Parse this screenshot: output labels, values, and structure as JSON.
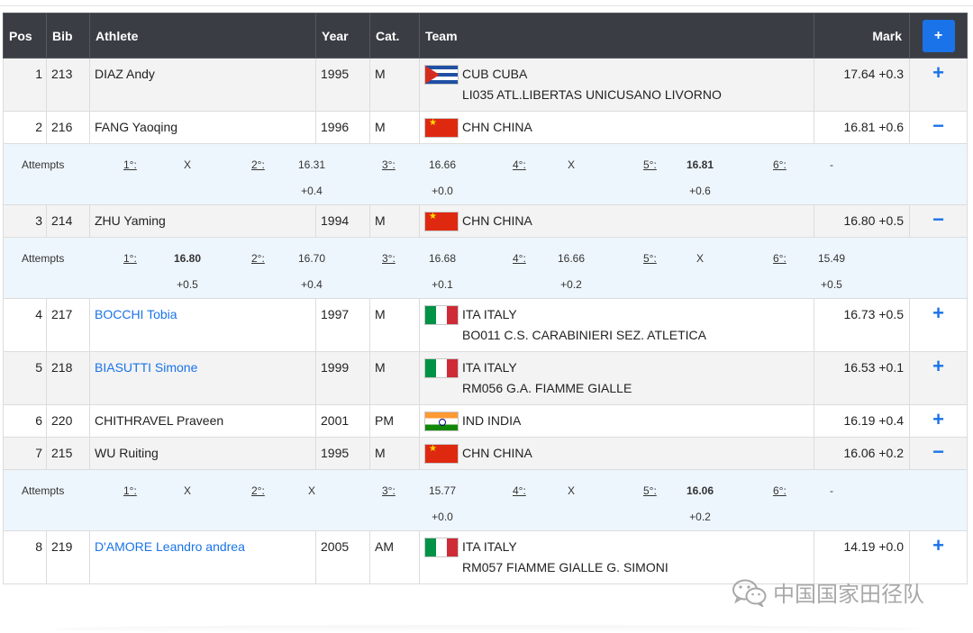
{
  "header": {
    "pos": "Pos",
    "bib": "Bib",
    "athlete": "Athlete",
    "year": "Year",
    "cat": "Cat.",
    "team": "Team",
    "mark": "Mark",
    "expand_all": "+"
  },
  "attempts_label": "Attempts",
  "attempt_numbers": [
    "1°:",
    "2°:",
    "3°:",
    "4°:",
    "5°:",
    "6°:"
  ],
  "rows": [
    {
      "pos": "1",
      "bib": "213",
      "athlete": "DIAZ Andy",
      "linked": false,
      "year": "1995",
      "cat": "M",
      "flag": "cuba-flag",
      "country": "CUB CUBA",
      "club": "LI035 ATL.LIBERTAS UNICUSANO LIVORNO",
      "mark": "17.64 +0.3",
      "toggle": "+"
    },
    {
      "pos": "2",
      "bib": "216",
      "athlete": "FANG Yaoqing",
      "linked": false,
      "year": "1996",
      "cat": "M",
      "flag": "china-flag",
      "country": "CHN CHINA",
      "club": "",
      "mark": "16.81 +0.6",
      "toggle": "−",
      "attempts": [
        {
          "mark": "X",
          "wind": ""
        },
        {
          "mark": "16.31",
          "wind": "+0.4"
        },
        {
          "mark": "16.66",
          "wind": "+0.0"
        },
        {
          "mark": "X",
          "wind": ""
        },
        {
          "mark": "16.81",
          "wind": "+0.6",
          "best": true
        },
        {
          "mark": "-",
          "wind": ""
        }
      ]
    },
    {
      "pos": "3",
      "bib": "214",
      "athlete": "ZHU Yaming",
      "linked": false,
      "year": "1994",
      "cat": "M",
      "flag": "china-flag",
      "country": "CHN CHINA",
      "club": "",
      "mark": "16.80 +0.5",
      "toggle": "−",
      "attempts": [
        {
          "mark": "16.80",
          "wind": "+0.5",
          "best": true
        },
        {
          "mark": "16.70",
          "wind": "+0.4"
        },
        {
          "mark": "16.68",
          "wind": "+0.1"
        },
        {
          "mark": "16.66",
          "wind": "+0.2"
        },
        {
          "mark": "X",
          "wind": ""
        },
        {
          "mark": "15.49",
          "wind": "+0.5"
        }
      ]
    },
    {
      "pos": "4",
      "bib": "217",
      "athlete": "BOCCHI Tobia",
      "linked": true,
      "year": "1997",
      "cat": "M",
      "flag": "italy-flag",
      "country": "ITA ITALY",
      "club": "BO011 C.S. CARABINIERI SEZ. ATLETICA",
      "mark": "16.73 +0.5",
      "toggle": "+"
    },
    {
      "pos": "5",
      "bib": "218",
      "athlete": "BIASUTTI Simone",
      "linked": true,
      "year": "1999",
      "cat": "M",
      "flag": "italy-flag",
      "country": "ITA ITALY",
      "club": "RM056 G.A. FIAMME GIALLE",
      "mark": "16.53 +0.1",
      "toggle": "+"
    },
    {
      "pos": "6",
      "bib": "220",
      "athlete": "CHITHRAVEL Praveen",
      "linked": false,
      "year": "2001",
      "cat": "PM",
      "flag": "india-flag",
      "country": "IND INDIA",
      "club": "",
      "mark": "16.19 +0.4",
      "toggle": "+"
    },
    {
      "pos": "7",
      "bib": "215",
      "athlete": "WU Ruiting",
      "linked": false,
      "year": "1995",
      "cat": "M",
      "flag": "china-flag",
      "country": "CHN CHINA",
      "club": "",
      "mark": "16.06 +0.2",
      "toggle": "−",
      "attempts": [
        {
          "mark": "X",
          "wind": ""
        },
        {
          "mark": "X",
          "wind": ""
        },
        {
          "mark": "15.77",
          "wind": "+0.0"
        },
        {
          "mark": "X",
          "wind": ""
        },
        {
          "mark": "16.06",
          "wind": "+0.2",
          "best": true
        },
        {
          "mark": "-",
          "wind": ""
        }
      ]
    },
    {
      "pos": "8",
      "bib": "219",
      "athlete": "D'AMORE Leandro andrea",
      "linked": true,
      "year": "2005",
      "cat": "AM",
      "flag": "italy-flag",
      "country": "ITA ITALY",
      "club": "RM057 FIAMME GIALLE G. SIMONI",
      "mark": "14.19 +0.0",
      "toggle": "+"
    }
  ],
  "watermark": {
    "icon": "wechat-icon",
    "text": "中国国家田径队"
  },
  "colors": {
    "header_bg": "#3a3e44",
    "accent": "#1a73e8",
    "attempts_bg": "#eef6fd",
    "row_grey": "#f3f3f3"
  }
}
